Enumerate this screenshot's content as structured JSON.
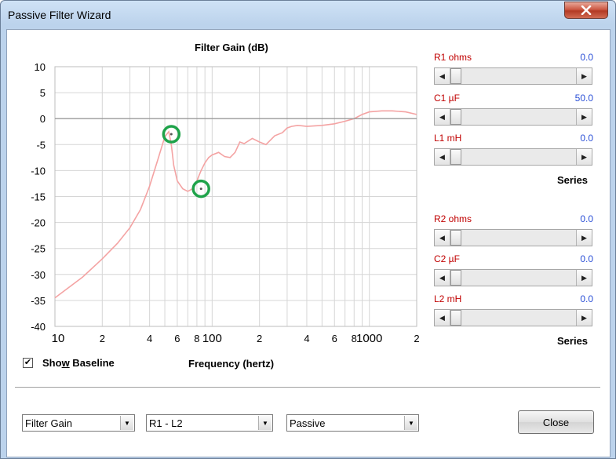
{
  "window": {
    "title": "Passive Filter Wizard"
  },
  "chart": {
    "title": "Filter Gain (dB)",
    "xlabel": "Frequency (hertz)"
  },
  "chart_data": {
    "type": "line",
    "title": "Filter Gain (dB)",
    "xlabel": "Frequency (hertz)",
    "ylabel": "",
    "x_scale": "log",
    "xlim": [
      10,
      2000
    ],
    "ylim": [
      -40,
      10
    ],
    "y_ticks": [
      "10",
      "5",
      "0",
      "-5",
      "-10",
      "-15",
      "-20",
      "-25",
      "-30",
      "-35",
      "-40"
    ],
    "x_ticks": [
      "10",
      "2",
      "4",
      "6",
      "8",
      "100",
      "2",
      "4",
      "6",
      "8",
      "1000",
      "2"
    ],
    "grid": true,
    "series": [
      {
        "color": "#f4a3a3",
        "x": [
          10,
          15,
          20,
          25,
          30,
          35,
          40,
          45,
          50,
          53,
          55,
          57,
          60,
          65,
          70,
          75,
          80,
          85,
          90,
          95,
          100,
          110,
          120,
          130,
          140,
          150,
          160,
          180,
          200,
          220,
          250,
          280,
          300,
          320,
          350,
          400,
          500,
          600,
          700,
          800,
          900,
          1000,
          1200,
          1400,
          1700,
          2000
        ],
        "y": [
          -34.5,
          -30.5,
          -27,
          -24,
          -21,
          -17.5,
          -13,
          -8,
          -3.5,
          -2.5,
          -5,
          -9,
          -12,
          -13.5,
          -14,
          -13.5,
          -12,
          -10,
          -8.5,
          -7.5,
          -7,
          -6.5,
          -7.3,
          -7.5,
          -6.5,
          -4.5,
          -4.8,
          -3.8,
          -4.5,
          -5,
          -3.3,
          -2.7,
          -1.8,
          -1.5,
          -1.3,
          -1.5,
          -1.3,
          -1,
          -0.5,
          0,
          0.8,
          1.3,
          1.5,
          1.5,
          1.3,
          0.8
        ]
      },
      {
        "color": "#999999",
        "x": [
          10,
          2000
        ],
        "y": [
          0,
          0
        ]
      }
    ],
    "markers": [
      {
        "x": 55,
        "y": -3,
        "color": "#1fa34a"
      },
      {
        "x": 85,
        "y": -13.5,
        "color": "#1fa34a"
      }
    ]
  },
  "sliders": [
    {
      "label": "R1  ohms",
      "value": "0.0",
      "fraction": 0
    },
    {
      "label": "C1  µF",
      "value": "50.0",
      "fraction": 0
    },
    {
      "label": "L1  mH",
      "value": "0.0",
      "fraction": 0
    },
    {
      "label": "R2  ohms",
      "value": "0.0",
      "fraction": 0
    },
    {
      "label": "C2  µF",
      "value": "0.0",
      "fraction": 0
    },
    {
      "label": "L2  mH",
      "value": "0.0",
      "fraction": 0
    }
  ],
  "series_labels": [
    "Series",
    "Series"
  ],
  "checkbox": {
    "label_pre": "Sho",
    "label_accel": "w",
    "label_post": " Baseline",
    "checked": true
  },
  "combos": [
    {
      "value": "Filter Gain"
    },
    {
      "value": "R1 - L2"
    },
    {
      "value": "Passive"
    }
  ],
  "close_button": "Close"
}
